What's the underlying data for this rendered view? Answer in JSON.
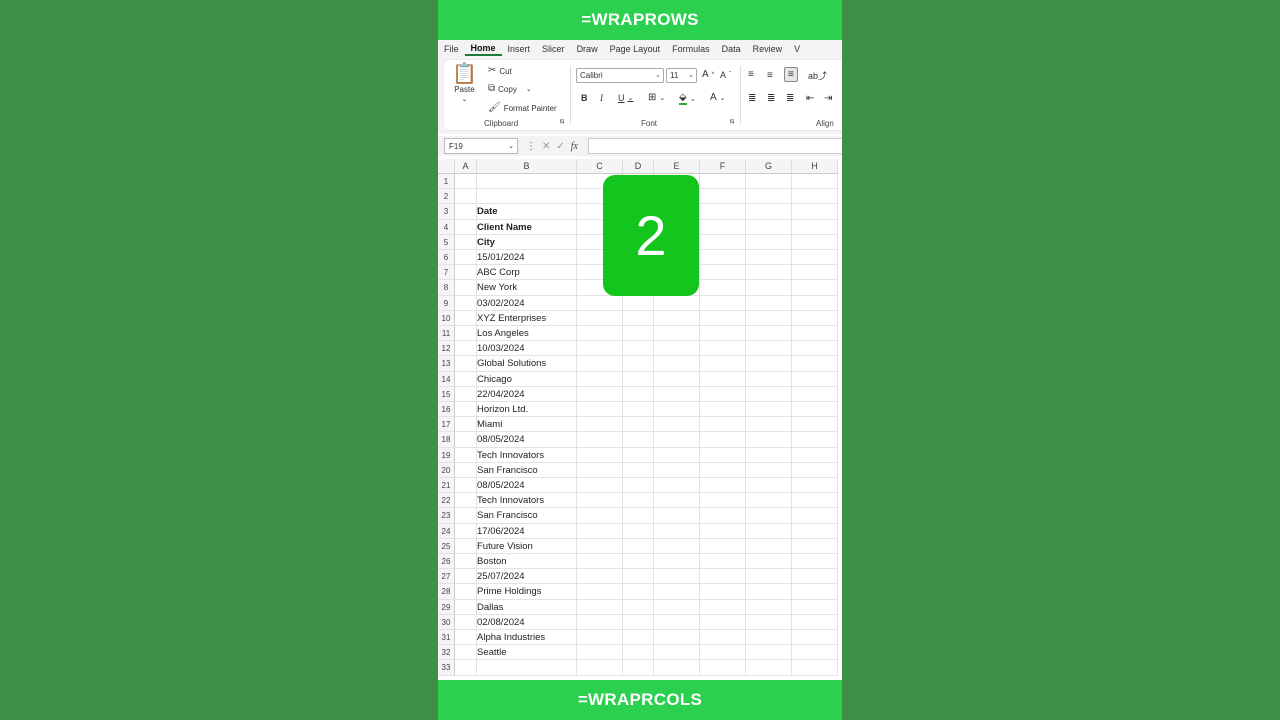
{
  "banner_top": "=WRAPROWS",
  "banner_bottom": "=WRAPRCOLS",
  "menu": [
    "File",
    "Home",
    "Insert",
    "Slicer",
    "Draw",
    "Page Layout",
    "Formulas",
    "Data",
    "Review",
    "V"
  ],
  "ribbon": {
    "paste": "Paste",
    "cut": "Cut",
    "copy": "Copy",
    "format_painter": "Format Painter",
    "clipboard": "Clipboard",
    "font_name": "Calibri",
    "font_size": "11",
    "font_group": "Font",
    "align_group": "Align",
    "bold": "B",
    "italic": "I",
    "underline": "U",
    "font_color": "A",
    "grow": "A",
    "shrink": "A"
  },
  "formula_bar": {
    "name_box": "F19",
    "fx": "fx",
    "value": ""
  },
  "columns": [
    "A",
    "B",
    "C",
    "D",
    "E",
    "F",
    "G",
    "H"
  ],
  "row_numbers": [
    "1",
    "2",
    "3",
    "4",
    "5",
    "6",
    "7",
    "8",
    "9",
    "10",
    "11",
    "12",
    "13",
    "14",
    "15",
    "16",
    "17",
    "18",
    "19",
    "20",
    "21",
    "22",
    "23",
    "24",
    "25",
    "26",
    "27",
    "28",
    "29",
    "30",
    "31",
    "32",
    "33"
  ],
  "cells_b": [
    {
      "row": 3,
      "text": "Date",
      "bold": true
    },
    {
      "row": 4,
      "text": "Client Name",
      "bold": true
    },
    {
      "row": 5,
      "text": "City",
      "bold": true
    },
    {
      "row": 6,
      "text": "15/01/2024"
    },
    {
      "row": 7,
      "text": "ABC Corp"
    },
    {
      "row": 8,
      "text": "New York"
    },
    {
      "row": 9,
      "text": "03/02/2024"
    },
    {
      "row": 10,
      "text": "XYZ Enterprises"
    },
    {
      "row": 11,
      "text": "Los Angeles"
    },
    {
      "row": 12,
      "text": "10/03/2024"
    },
    {
      "row": 13,
      "text": "Global Solutions"
    },
    {
      "row": 14,
      "text": "Chicago"
    },
    {
      "row": 15,
      "text": "22/04/2024"
    },
    {
      "row": 16,
      "text": "Horizon Ltd."
    },
    {
      "row": 17,
      "text": "Miami"
    },
    {
      "row": 18,
      "text": "08/05/2024"
    },
    {
      "row": 19,
      "text": "Tech Innovators"
    },
    {
      "row": 20,
      "text": "San Francisco"
    },
    {
      "row": 21,
      "text": "08/05/2024"
    },
    {
      "row": 22,
      "text": "Tech Innovators"
    },
    {
      "row": 23,
      "text": "San Francisco"
    },
    {
      "row": 24,
      "text": "17/06/2024"
    },
    {
      "row": 25,
      "text": "Future Vision"
    },
    {
      "row": 26,
      "text": "Boston"
    },
    {
      "row": 27,
      "text": "25/07/2024"
    },
    {
      "row": 28,
      "text": "Prime Holdings"
    },
    {
      "row": 29,
      "text": "Dallas"
    },
    {
      "row": 30,
      "text": "02/08/2024"
    },
    {
      "row": 31,
      "text": "Alpha Industries"
    },
    {
      "row": 32,
      "text": "Seattle"
    }
  ],
  "step_badge": "2",
  "colors": {
    "banner": "#2bd14e",
    "badge": "#13c51d",
    "background": "#3e9047"
  }
}
